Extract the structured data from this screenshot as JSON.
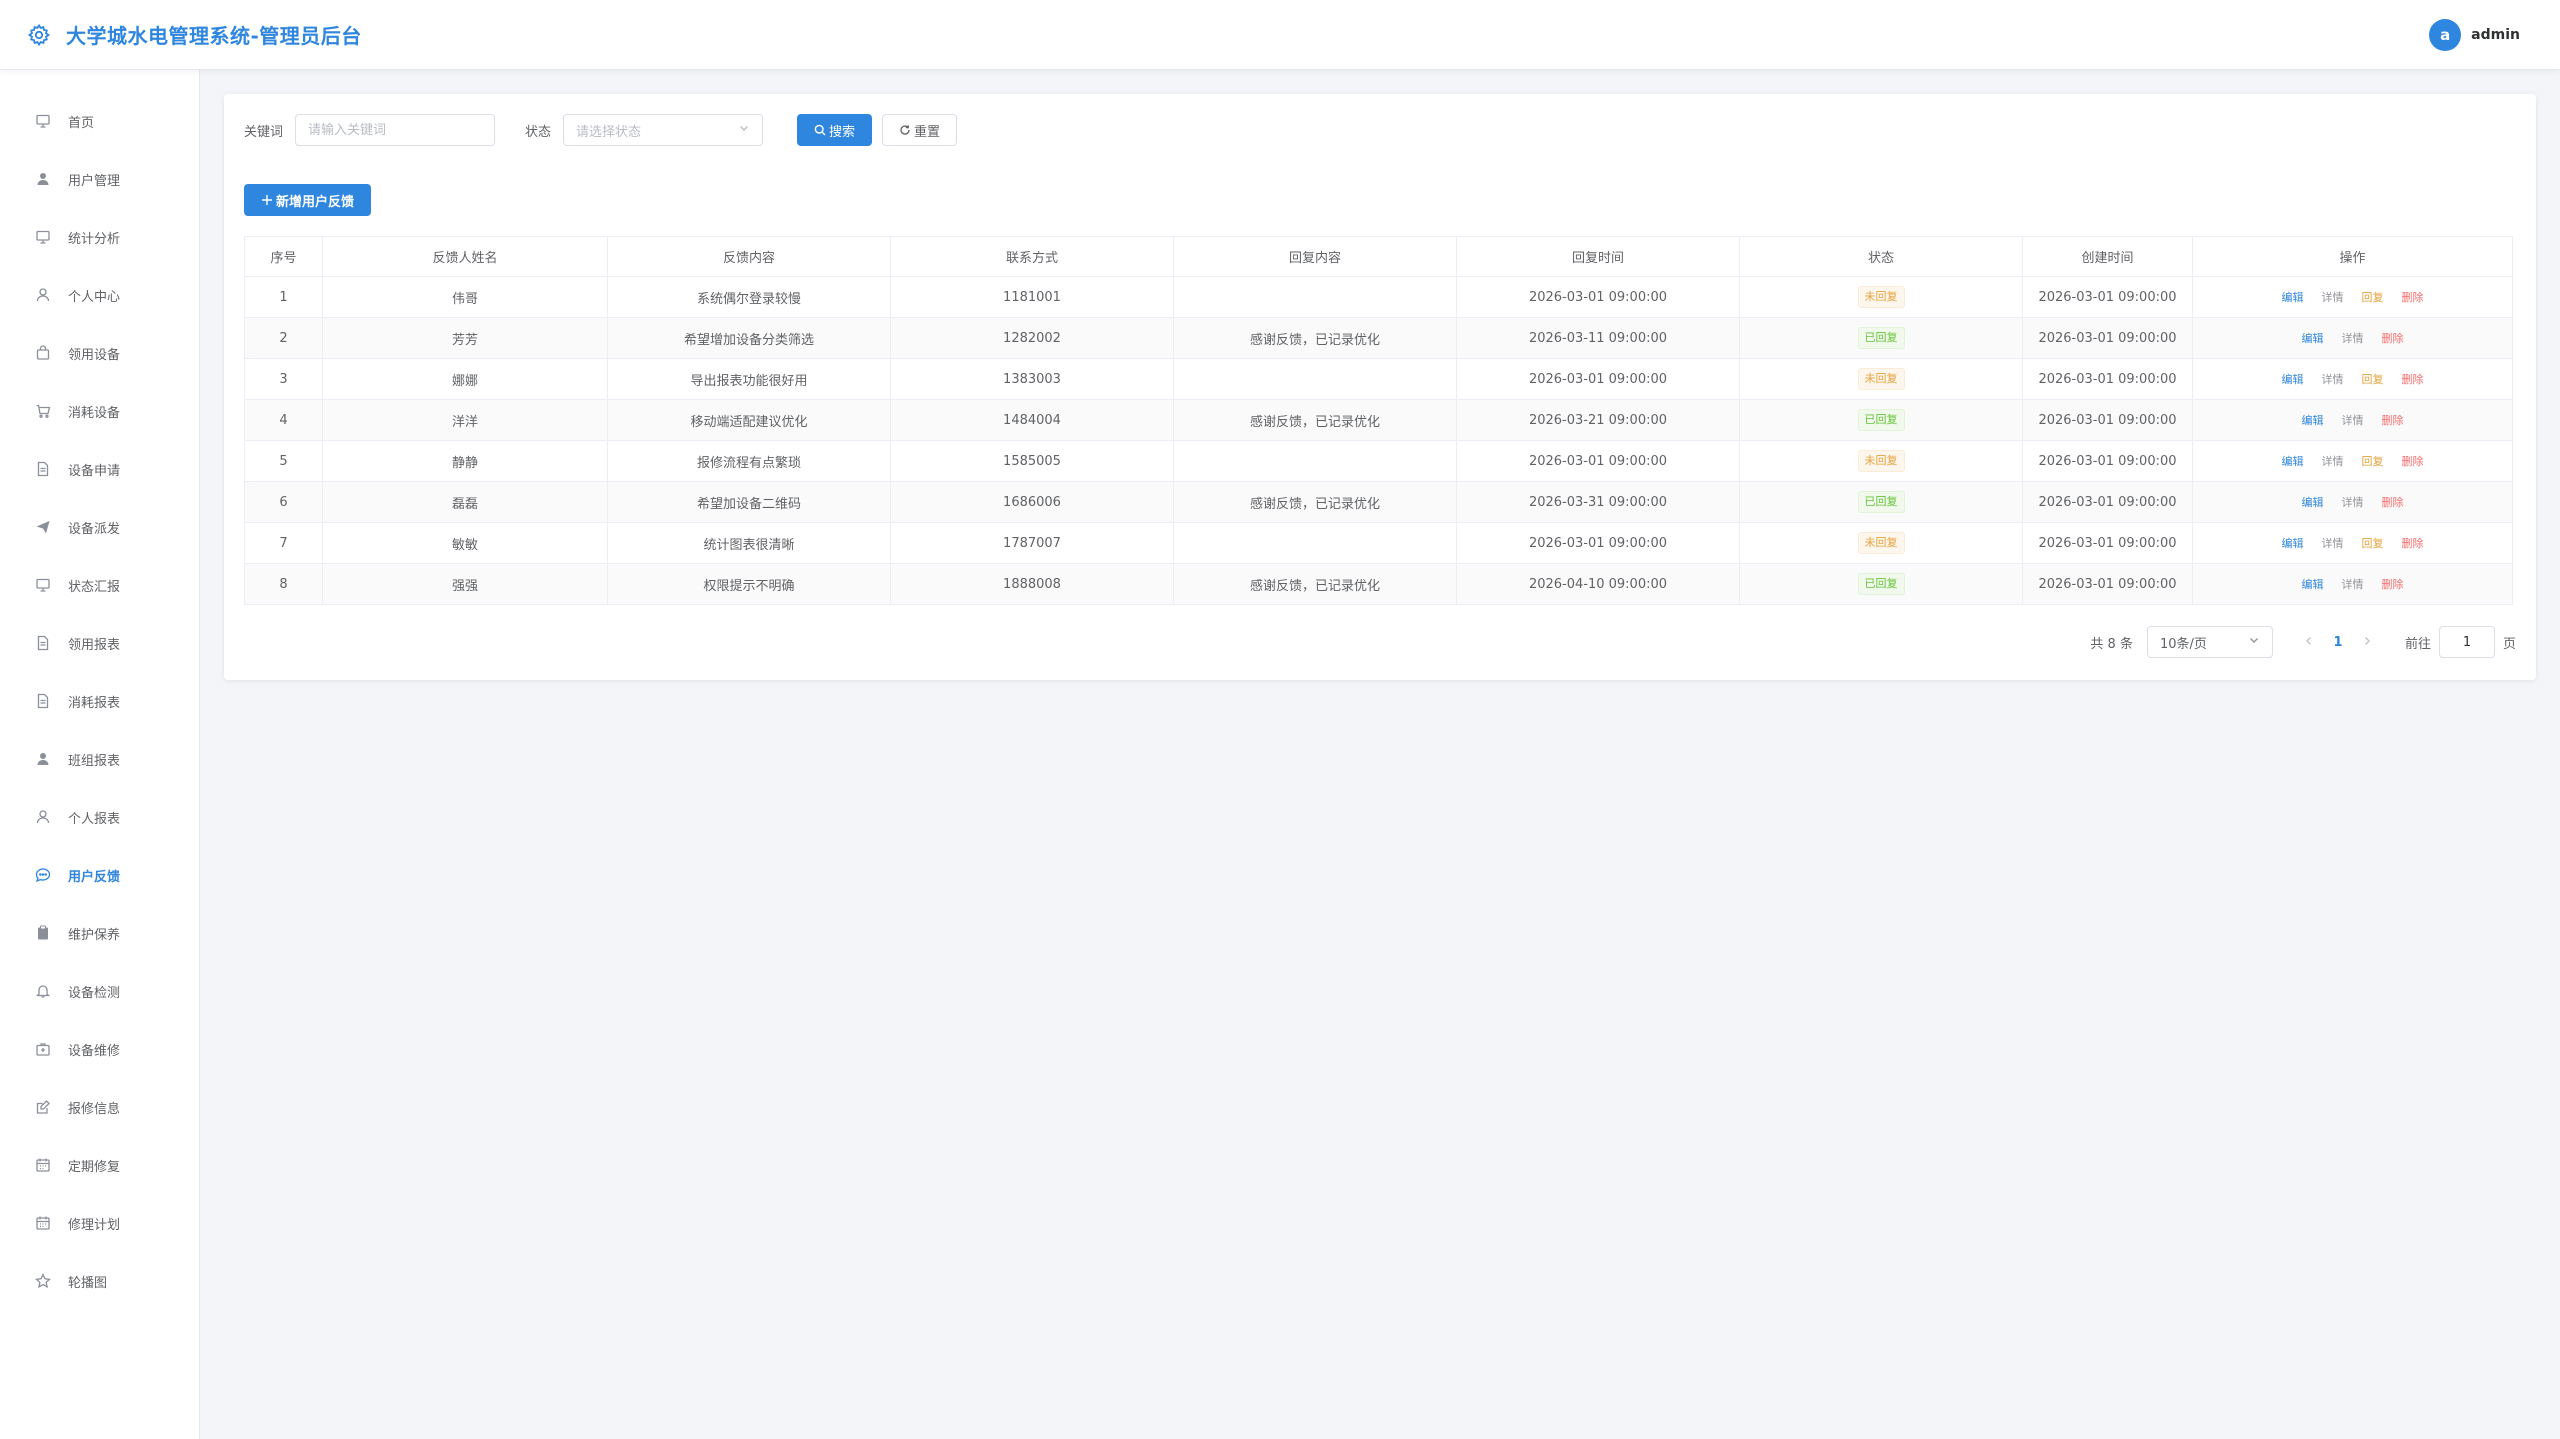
{
  "header": {
    "title": "大学城水电管理系统-管理员后台",
    "avatar_letter": "a",
    "user_name": "admin"
  },
  "colors": {
    "primary": "#2e86de",
    "warning": "#e6a23c",
    "success": "#67c23a",
    "danger": "#f56c6c"
  },
  "sidebar": {
    "active_index": 13,
    "items": [
      {
        "label": "首页",
        "icon": "monitor-icon"
      },
      {
        "label": "用户管理",
        "icon": "user-filled-icon"
      },
      {
        "label": "统计分析",
        "icon": "monitor-icon"
      },
      {
        "label": "个人中心",
        "icon": "user-icon"
      },
      {
        "label": "领用设备",
        "icon": "bag-icon"
      },
      {
        "label": "消耗设备",
        "icon": "cart-icon"
      },
      {
        "label": "设备申请",
        "icon": "document-icon"
      },
      {
        "label": "设备派发",
        "icon": "send-icon"
      },
      {
        "label": "状态汇报",
        "icon": "monitor-icon"
      },
      {
        "label": "领用报表",
        "icon": "document-icon"
      },
      {
        "label": "消耗报表",
        "icon": "document-icon"
      },
      {
        "label": "班组报表",
        "icon": "user-filled-icon"
      },
      {
        "label": "个人报表",
        "icon": "user-icon"
      },
      {
        "label": "用户反馈",
        "icon": "chat-icon"
      },
      {
        "label": "维护保养",
        "icon": "clipboard-icon"
      },
      {
        "label": "设备检测",
        "icon": "bell-icon"
      },
      {
        "label": "设备维修",
        "icon": "toolbox-icon"
      },
      {
        "label": "报修信息",
        "icon": "edit-icon"
      },
      {
        "label": "定期修复",
        "icon": "calendar-icon"
      },
      {
        "label": "修理计划",
        "icon": "calendar-icon"
      },
      {
        "label": "轮播图",
        "icon": "star-icon"
      }
    ]
  },
  "filter": {
    "keyword_label": "关键词",
    "keyword_placeholder": "请输入关键词",
    "keyword_value": "",
    "status_label": "状态",
    "status_placeholder": "请选择状态",
    "search_label": "搜索",
    "reset_label": "重置"
  },
  "add_button": "新增用户反馈",
  "table": {
    "headers": [
      "序号",
      "反馈人姓名",
      "反馈内容",
      "联系方式",
      "回复内容",
      "回复时间",
      "状态",
      "创建时间",
      "操作"
    ],
    "rows": [
      {
        "no": "1",
        "name": "伟哥",
        "content": "系统偶尔登录较慢",
        "contact": "1181001",
        "reply": "",
        "reply_time": "2026-03-01 09:00:00",
        "status": "未回复",
        "status_type": "pending",
        "created": "2026-03-01 09:00:00"
      },
      {
        "no": "2",
        "name": "芳芳",
        "content": "希望增加设备分类筛选",
        "contact": "1282002",
        "reply": "感谢反馈，已记录优化",
        "reply_time": "2026-03-11 09:00:00",
        "status": "已回复",
        "status_type": "done",
        "created": "2026-03-01 09:00:00"
      },
      {
        "no": "3",
        "name": "娜娜",
        "content": "导出报表功能很好用",
        "contact": "1383003",
        "reply": "",
        "reply_time": "2026-03-01 09:00:00",
        "status": "未回复",
        "status_type": "pending",
        "created": "2026-03-01 09:00:00"
      },
      {
        "no": "4",
        "name": "洋洋",
        "content": "移动端适配建议优化",
        "contact": "1484004",
        "reply": "感谢反馈，已记录优化",
        "reply_time": "2026-03-21 09:00:00",
        "status": "已回复",
        "status_type": "done",
        "created": "2026-03-01 09:00:00"
      },
      {
        "no": "5",
        "name": "静静",
        "content": "报修流程有点繁琐",
        "contact": "1585005",
        "reply": "",
        "reply_time": "2026-03-01 09:00:00",
        "status": "未回复",
        "status_type": "pending",
        "created": "2026-03-01 09:00:00"
      },
      {
        "no": "6",
        "name": "磊磊",
        "content": "希望加设备二维码",
        "contact": "1686006",
        "reply": "感谢反馈，已记录优化",
        "reply_time": "2026-03-31 09:00:00",
        "status": "已回复",
        "status_type": "done",
        "created": "2026-03-01 09:00:00"
      },
      {
        "no": "7",
        "name": "敏敏",
        "content": "统计图表很清晰",
        "contact": "1787007",
        "reply": "",
        "reply_time": "2026-03-01 09:00:00",
        "status": "未回复",
        "status_type": "pending",
        "created": "2026-03-01 09:00:00"
      },
      {
        "no": "8",
        "name": "强强",
        "content": "权限提示不明确",
        "contact": "1888008",
        "reply": "感谢反馈，已记录优化",
        "reply_time": "2026-04-10 09:00:00",
        "status": "已回复",
        "status_type": "done",
        "created": "2026-03-01 09:00:00"
      }
    ],
    "actions": {
      "edit": "编辑",
      "detail": "详情",
      "reply": "回复",
      "delete": "删除"
    }
  },
  "pagination": {
    "total_text": "共 8 条",
    "page_size": "10条/页",
    "current_page": "1",
    "goto_label": "前往",
    "goto_value": "1",
    "page_unit": "页"
  }
}
